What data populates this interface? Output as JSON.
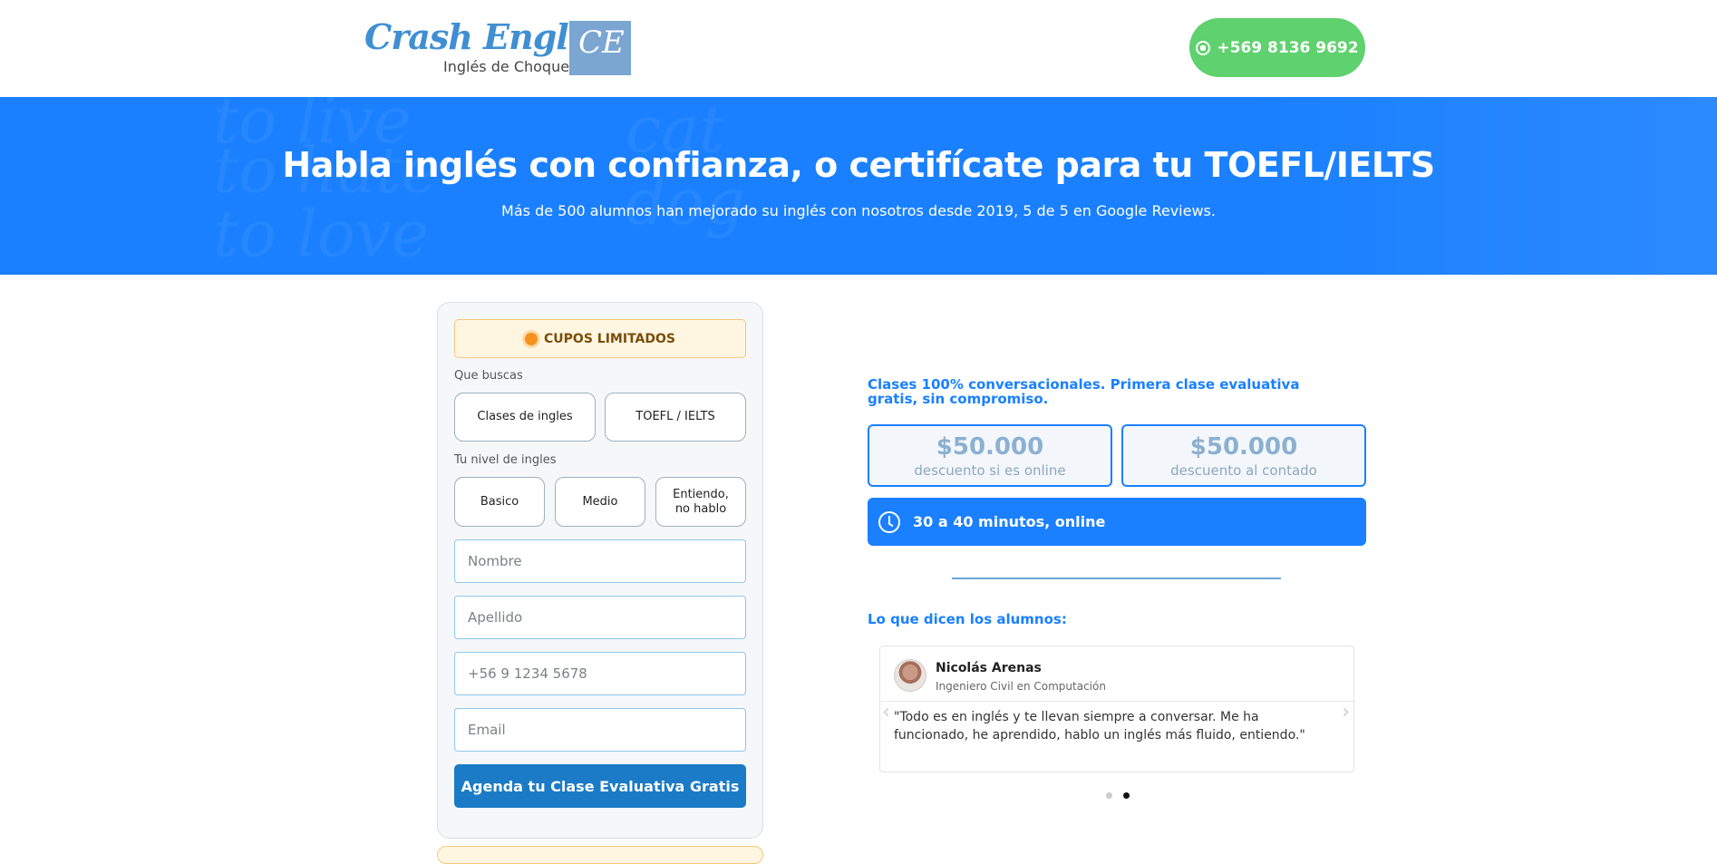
{
  "header": {
    "logo": {
      "brand": "Crash English",
      "tagline": "Inglés de Choque",
      "mark": "CE"
    },
    "phone_label": "+569 8136 9692"
  },
  "hero": {
    "title": "Habla inglés con confianza, o certifícate para tu TOEFL/IELTS",
    "subtitle": "Más de 500 alumnos han mejorado su inglés con nosotros desde 2019, 5 de 5 en Google Reviews.",
    "background_words": [
      "to live",
      "to hate",
      "to love",
      "cat",
      "dog"
    ]
  },
  "form": {
    "badge": "CUPOS LIMITADOS",
    "search_label": "Que buscas",
    "search_options": [
      "Clases de ingles",
      "TOEFL / IELTS"
    ],
    "level_label": "Tu nivel de ingles",
    "level_options": [
      "Basico",
      "Medio",
      "Entiendo, no hablo"
    ],
    "fields": {
      "first_name_placeholder": "Nombre",
      "last_name_placeholder": "Apellido",
      "phone_placeholder": "+56 9 1234 5678",
      "email_placeholder": "Email"
    },
    "submit_label": "Agenda tu Clase Evaluativa Gratis"
  },
  "offer": {
    "promo": "Clases 100% conversacionales. Primera clase evaluativa gratis, sin compromiso.",
    "prices": [
      {
        "amount": "$50.000",
        "note": "descuento si es online"
      },
      {
        "amount": "$50.000",
        "note": "descuento al contado"
      }
    ],
    "duration": "30 a 40 minutos, online"
  },
  "reviews": {
    "heading": "Lo que dicen los alumnos:",
    "current": {
      "name": "Nicolás Arenas",
      "role": "Ingeniero Civil en Computación",
      "text": "\"Todo es en inglés y te llevan siempre a conversar. Me ha funcionado, he aprendido, hablo un inglés más fluido, entiendo.\""
    },
    "dots": 2,
    "active_dot": 2
  },
  "colors": {
    "primary": "#1a80ff",
    "whatsapp": "#5fd16e",
    "submit": "#1b7bc6",
    "badge_bg": "#fff6e2",
    "badge_dot": "#f5921e"
  }
}
